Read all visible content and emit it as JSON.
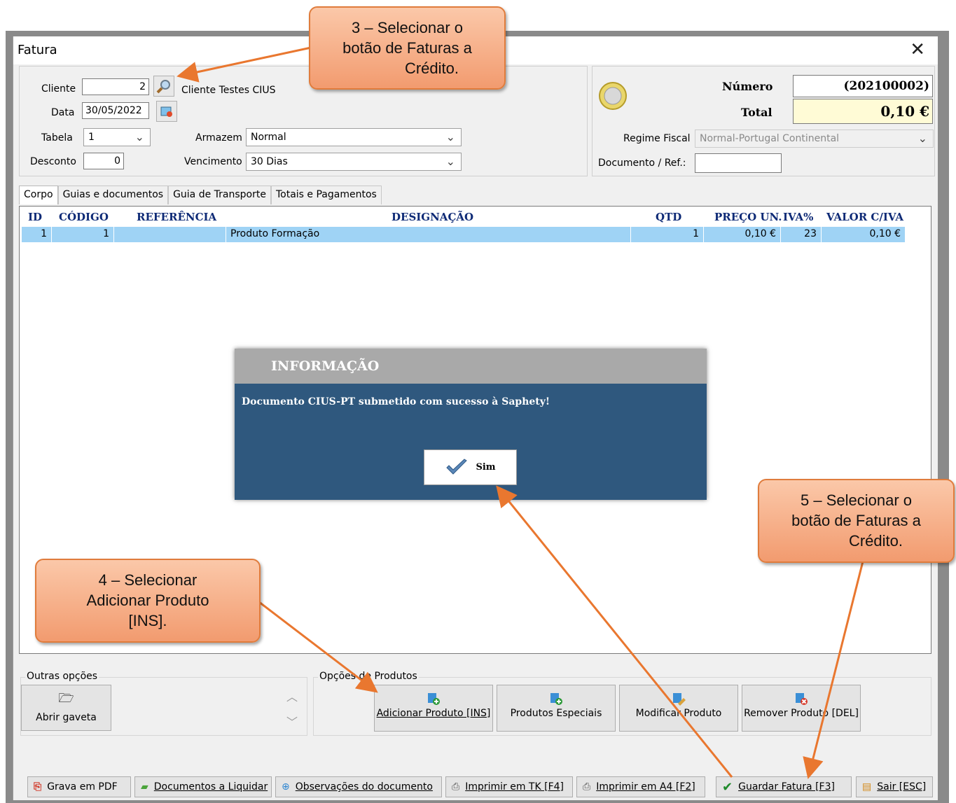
{
  "window": {
    "title": "Fatura"
  },
  "header": {
    "cliente_label": "Cliente",
    "cliente_value": "2",
    "cliente_name": "Cliente Testes CIUS",
    "data_label": "Data",
    "data_value": "30/05/2022",
    "tabela_label": "Tabela",
    "tabela_value": "1",
    "desconto_label": "Desconto",
    "desconto_value": "0",
    "armazem_label": "Armazem",
    "armazem_value": "Normal",
    "vencimento_label": "Vencimento",
    "vencimento_value": "30 Dias"
  },
  "summary": {
    "numero_label": "Número",
    "numero_value": "(202100002)",
    "total_label": "Total",
    "total_value": "0,10 €",
    "regime_label": "Regime Fiscal",
    "regime_value": "Normal-Portugal Continental",
    "documento_label": "Documento / Ref.:",
    "documento_value": ""
  },
  "tabs": [
    "Corpo",
    "Guias e documentos",
    "Guia de Transporte",
    "Totais e Pagamentos"
  ],
  "grid": {
    "columns": [
      "ID",
      "CÓDIGO",
      "REFERÊNCIA",
      "DESIGNAÇÃO",
      "QTD",
      "PREÇO UN.",
      "IVA%",
      "VALOR C/IVA"
    ],
    "rows": [
      {
        "id": "1",
        "codigo": "1",
        "referencia": "",
        "designacao": "Produto Formação",
        "qtd": "1",
        "preco": "0,10 €",
        "iva": "23",
        "valor": "0,10 €"
      }
    ]
  },
  "outras_opcoes": {
    "label": "Outras opções",
    "abrir_gaveta": "Abrir gaveta"
  },
  "opcoes_produtos": {
    "label": "Opções de Produtos",
    "adicionar": "Adicionar Produto [INS]",
    "especiais": "Produtos Especiais",
    "modificar": "Modificar Produto",
    "remover": "Remover Produto [DEL]"
  },
  "footer": {
    "pdf": "Grava em PDF",
    "liquidar": "Documentos a Liquidar",
    "observacoes": "Observações do documento",
    "tk": "Imprimir em TK [F4]",
    "a4": "Imprimir em A4 [F2]",
    "guardar": "Guardar Fatura [F3]",
    "sair": "Sair [ESC]"
  },
  "modal": {
    "title": "INFORMAÇÃO",
    "message": "Documento CIUS-PT submetido com sucesso à Saphety!",
    "button": "Sim"
  },
  "callouts": {
    "c3": [
      "3 – Selecionar o",
      "botão de Faturas a",
      "Crédito."
    ],
    "c4": [
      "4 – Selecionar",
      "Adicionar Produto",
      "[INS]."
    ],
    "c5": [
      "5 – Selecionar o",
      "botão de Faturas a",
      "Crédito."
    ]
  },
  "colors": {
    "accent_orange": "#f29b6f",
    "modal_blue": "#2f587e",
    "grid_header_blue": "#0e2a76",
    "row_selected": "#9fd3f5"
  }
}
